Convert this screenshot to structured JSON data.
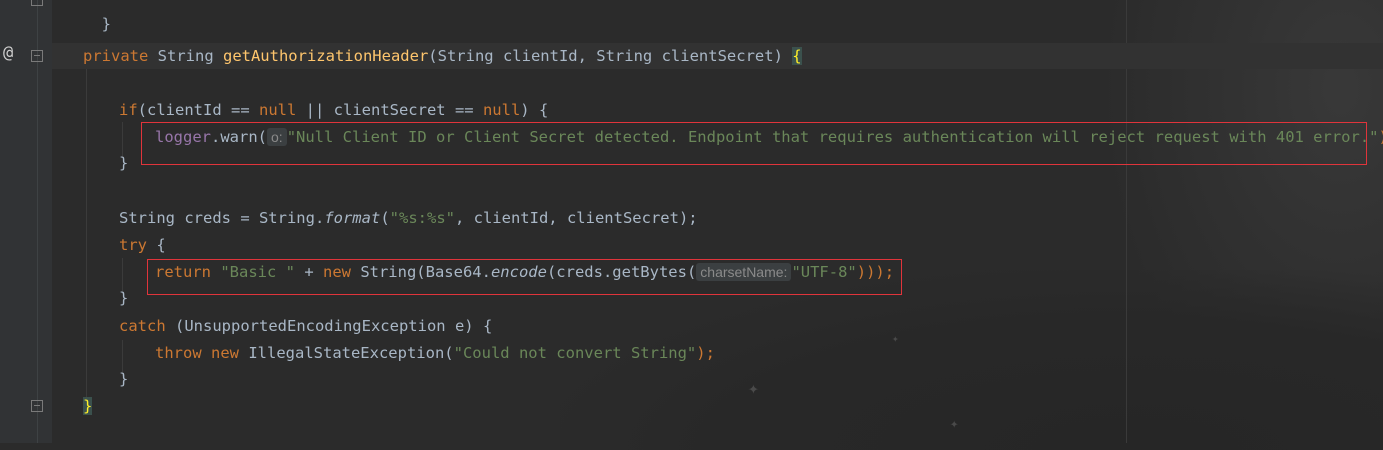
{
  "editor": {
    "line_0": "}",
    "line_sig": {
      "kw_private": "private",
      "type1": " String ",
      "method": "getAuthorizationHeader",
      "params": "(String clientId, String clientSecret) ",
      "brace": "{"
    },
    "line_if": {
      "kw_if": "if",
      "rest1": "(clientId == ",
      "null1": "null",
      "rest2": " || clientSecret == ",
      "null2": "null",
      "rest3": ") {"
    },
    "line_warn": {
      "logger": "logger",
      "call": ".warn(",
      "hint": "o:",
      "msg": "\"Null Client ID or Client Secret detected. Endpoint that requires authentication will reject request with 401 error.\"",
      "end": ");"
    },
    "line_close1": "}",
    "line_creds": {
      "pre": "String creds = String.",
      "fn": "format",
      "open": "(",
      "fmt": "\"%s:%s\"",
      "rest": ", clientId, clientSecret);"
    },
    "line_try": {
      "kw": "try",
      "rest": " {"
    },
    "line_return": {
      "kw_return": "return ",
      "str_basic": "\"Basic \"",
      "plus": " + ",
      "kw_new": "new ",
      "pre": "String(Base64.",
      "fn": "encode",
      "mid": "(creds.getBytes(",
      "hint": "charsetName:",
      "str_utf": "\"UTF-8\"",
      "end": ")));"
    },
    "line_close2": "}",
    "line_catch": {
      "kw": "catch",
      "rest": " (UnsupportedEncodingException e) {"
    },
    "line_throw": {
      "kw_throw": "throw ",
      "kw_new": "new ",
      "cls": "IllegalStateException(",
      "str": "\"Could not convert String\"",
      "end": ");"
    },
    "line_close3": "}",
    "line_close4": "}"
  },
  "gutter": {
    "icon": "@"
  },
  "colors": {
    "background": "#2b2b2b",
    "keyword": "#cc7832",
    "string": "#6a8759",
    "method": "#ffc66d",
    "highlight_box": "#e0343b"
  }
}
